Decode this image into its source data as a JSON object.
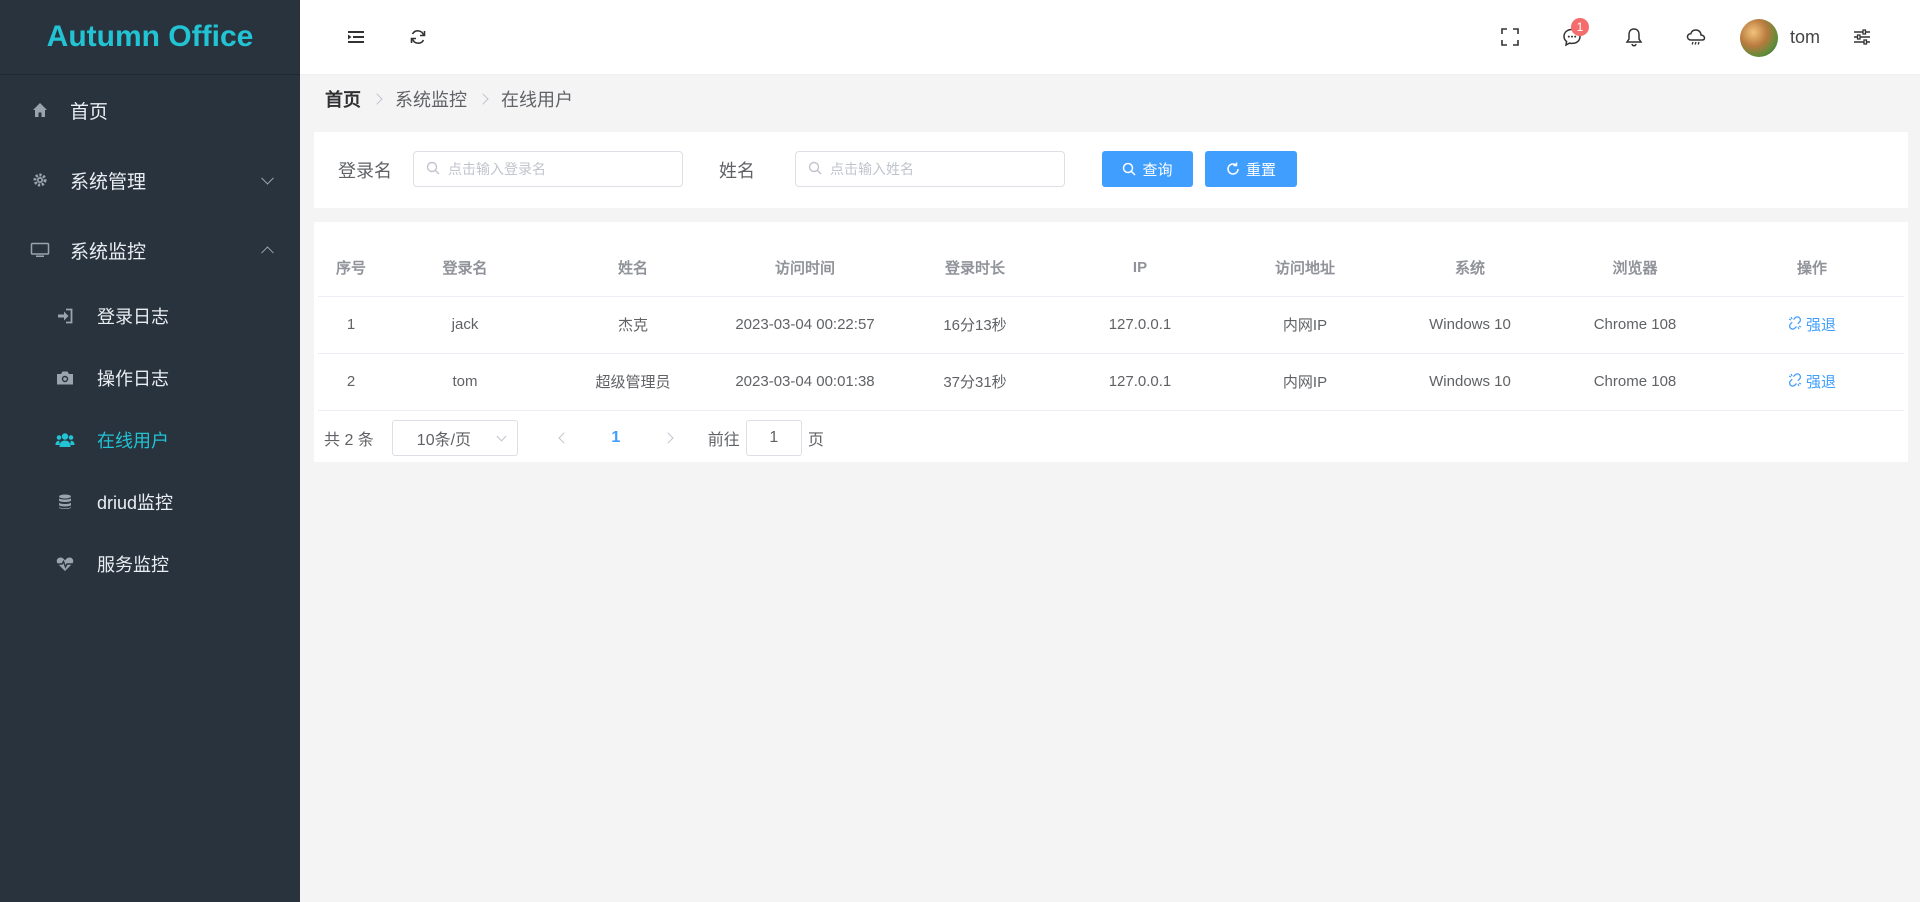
{
  "brand": "Autumn Office",
  "menu": {
    "home": "首页",
    "system_management": "系统管理",
    "system_monitor": "系统监控",
    "sub": {
      "login_log": "登录日志",
      "operation_log": "操作日志",
      "online_users": "在线用户",
      "druid_monitor": "driud监控",
      "service_monitor": "服务监控"
    }
  },
  "header": {
    "message_badge": "1",
    "username": "tom"
  },
  "breadcrumb": [
    "首页",
    "系统监控",
    "在线用户"
  ],
  "search": {
    "login_label": "登录名",
    "login_placeholder": "点击输入登录名",
    "name_label": "姓名",
    "name_placeholder": "点击输入姓名",
    "query_button": "查询",
    "reset_button": "重置"
  },
  "table": {
    "headers": [
      "序号",
      "登录名",
      "姓名",
      "访问时间",
      "登录时长",
      "IP",
      "访问地址",
      "系统",
      "浏览器",
      "操作"
    ],
    "rows": [
      [
        "1",
        "jack",
        "杰克",
        "2023-03-04 00:22:57",
        "16分13秒",
        "127.0.0.1",
        "内网IP",
        "Windows 10",
        "Chrome 108",
        "强退"
      ],
      [
        "2",
        "tom",
        "超级管理员",
        "2023-03-04 00:01:38",
        "37分31秒",
        "127.0.0.1",
        "内网IP",
        "Windows 10",
        "Chrome 108",
        "强退"
      ]
    ]
  },
  "pagination": {
    "total": "共 2 条",
    "page_size": "10条/页",
    "current_page": "1",
    "goto_label": "前往",
    "goto_value": "1",
    "page_unit": "页"
  },
  "colors": {
    "sidebar_bg": "#28333e",
    "accent": "#22c3d3",
    "primary": "#409eff",
    "badge": "#f56c6c"
  },
  "icons": [
    "home-icon",
    "gear-icon",
    "monitor-icon",
    "sign-in-icon",
    "camera-icon",
    "users-icon",
    "database-icon",
    "heartbeat-icon",
    "menu-fold-icon",
    "refresh-icon",
    "fullscreen-icon",
    "chat-icon",
    "bell-icon",
    "cloud-icon",
    "settings-sliders-icon",
    "search-icon",
    "unlink-icon"
  ]
}
